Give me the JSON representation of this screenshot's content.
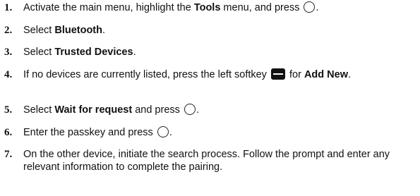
{
  "steps": [
    {
      "num": "1.",
      "pre": "Activate the main menu, highlight the ",
      "bold": "Tools",
      "post": " menu, and press",
      "end": "."
    },
    {
      "num": "2.",
      "pre": "Select ",
      "bold": "Bluetooth",
      "post": "."
    },
    {
      "num": "3.",
      "pre": "Select ",
      "bold": "Trusted Devices",
      "post": "."
    },
    {
      "num": "4.",
      "pre": "If no devices are currently listed, press the left softkey",
      "mid": "for",
      "bold": "Add New",
      "post": "."
    },
    {
      "num": "5.",
      "pre": "Select ",
      "bold": "Wait for request",
      "post": " and press",
      "end": "."
    },
    {
      "num": "6.",
      "pre": "Enter the passkey and press",
      "end": "."
    },
    {
      "num": "7.",
      "text": "On the other device, initiate the search process. Follow the prompt and enter any relevant information to complete the pairing."
    }
  ],
  "icons": {
    "select_key": "center-select-key-icon",
    "left_softkey": "left-softkey-icon"
  }
}
